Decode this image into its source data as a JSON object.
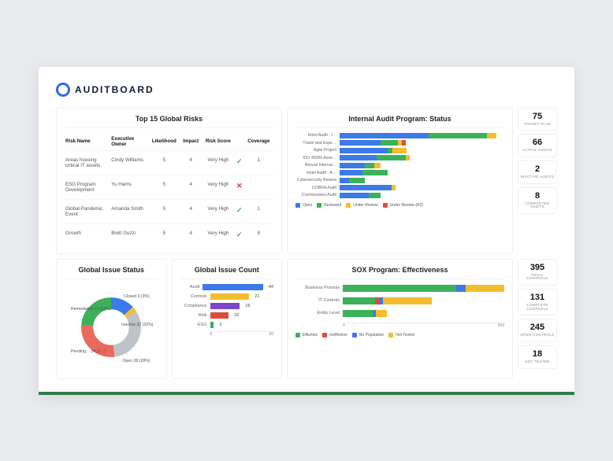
{
  "brand": {
    "name": "AUDITBOARD"
  },
  "risks": {
    "title": "Top 15 Global Risks",
    "columns": [
      "Risk Name",
      "Executive Owner",
      "Likelihood",
      "Impact",
      "Risk Score",
      "",
      "Coverage"
    ],
    "rows": [
      {
        "name": "Areas housing critical IT assets",
        "owner": "Cindy Williams",
        "lik": "5",
        "imp": "4",
        "score": "Very High",
        "covered": true,
        "coverage": "1"
      },
      {
        "name": "ESG Program Development",
        "owner": "Yu Harris",
        "lik": "5",
        "imp": "4",
        "score": "Very High",
        "covered": false,
        "coverage": ""
      },
      {
        "name": "Global Pandemic Event",
        "owner": "Amanda Smith",
        "lik": "5",
        "imp": "4",
        "score": "Very High",
        "covered": true,
        "coverage": "1"
      },
      {
        "name": "Growth",
        "owner": "Brett Guzzi",
        "lik": "5",
        "imp": "4",
        "score": "Very High",
        "covered": true,
        "coverage": "8"
      }
    ]
  },
  "internal_audit": {
    "title": "Internal Audit Program: Status",
    "legend": [
      "Open",
      "Reviewed",
      "Under Review",
      "Under Review (R2)"
    ]
  },
  "chart_data": [
    {
      "name": "internal_audit_status",
      "type": "bar",
      "orientation": "horizontal",
      "stacked": true,
      "categories": [
        "Hotel Audit - I…",
        "Travel and Expe…",
        "Agile Project",
        "ISO 45000 Asse…",
        "Annual Internal…",
        "Hotel Audit - A…",
        "Cybersecurity Review",
        "COBRA Audit",
        "Commissions Audit"
      ],
      "series": [
        {
          "name": "Open",
          "color": "#3b7ae8",
          "values": [
            92,
            42,
            50,
            38,
            26,
            24,
            10,
            54,
            30
          ]
        },
        {
          "name": "Reviewed",
          "color": "#3cb15a",
          "values": [
            60,
            18,
            5,
            30,
            10,
            26,
            16,
            0,
            12
          ]
        },
        {
          "name": "Under Review",
          "color": "#f2bd2e",
          "values": [
            10,
            4,
            14,
            4,
            6,
            0,
            0,
            4,
            0
          ]
        },
        {
          "name": "Under Review (R2)",
          "color": "#de4c3a",
          "values": [
            0,
            4,
            0,
            0,
            0,
            0,
            0,
            0,
            0
          ]
        }
      ],
      "xlim": [
        0,
        170
      ]
    },
    {
      "name": "global_issue_status",
      "type": "pie",
      "donut": true,
      "slices": [
        {
          "label": "Closed",
          "value": 3,
          "pct": 3,
          "color": "#f2bd2e",
          "text": "Closed 3 (3%)"
        },
        {
          "label": "Inactive",
          "value": 32,
          "pct": 32,
          "color": "#bfc3c8",
          "text": "Inactive 32 (32%)"
        },
        {
          "label": "Open",
          "value": 28,
          "pct": 28,
          "color": "#e86a5c",
          "text": "Open 28 (28%)"
        },
        {
          "label": "Pending…",
          "value": 24,
          "pct": 24,
          "color": "#3cb15a",
          "text": "Pending… 24 (2…)"
        },
        {
          "label": "Remediated",
          "value": 13,
          "pct": 13,
          "color": "#3b7ae8",
          "text": "Remediated 13 (13%)"
        }
      ]
    },
    {
      "name": "global_issue_count",
      "type": "bar",
      "orientation": "horizontal",
      "categories": [
        "Audit",
        "Controls",
        "Compliance",
        "Risk",
        "ESG"
      ],
      "values": [
        44,
        21,
        16,
        10,
        2
      ],
      "colors": [
        "#3b7ae8",
        "#f2bd2e",
        "#7b46c7",
        "#de4c3a",
        "#3cb15a"
      ],
      "xlim": [
        0,
        50
      ]
    },
    {
      "name": "sox_effectiveness",
      "type": "bar",
      "orientation": "horizontal",
      "stacked": true,
      "categories": [
        "Business Process",
        "IT Controls",
        "Entity Level"
      ],
      "series": [
        {
          "name": "Effective",
          "color": "#3cb15a",
          "values": [
            140,
            40,
            38
          ]
        },
        {
          "name": "Ineffective",
          "color": "#de4c3a",
          "values": [
            0,
            5,
            0
          ]
        },
        {
          "name": "No Population",
          "color": "#3b7ae8",
          "values": [
            12,
            5,
            3
          ]
        },
        {
          "name": "Not Tested",
          "color": "#f2bd2e",
          "values": [
            48,
            60,
            14
          ]
        }
      ],
      "xlim": [
        0,
        200
      ],
      "xticks": [
        0,
        200
      ]
    }
  ],
  "issue_status": {
    "title": "Global Issue Status"
  },
  "issue_count": {
    "title": "Global Issue Count",
    "axis": [
      "0",
      "50"
    ]
  },
  "sox": {
    "title": "SOX Program: Effectiveness",
    "legend": [
      "Effective",
      "Ineffective",
      "No Population",
      "Not Tested"
    ],
    "axis": [
      "0",
      "200"
    ]
  },
  "stats": [
    {
      "num": "75",
      "lbl": "TARGET PLAN"
    },
    {
      "num": "66",
      "lbl": "ACTIVE AUDITS"
    },
    {
      "num": "2",
      "lbl": "INACTIVE AUDITS"
    },
    {
      "num": "8",
      "lbl": "COMPLETED AUDITS"
    },
    {
      "num": "395",
      "lbl": "TOTAL CONTROLS"
    },
    {
      "num": "131",
      "lbl": "COMPLETE CONTROLS"
    },
    {
      "num": "245",
      "lbl": "OPEN CONTROLS"
    },
    {
      "num": "18",
      "lbl": "NOT TESTED"
    }
  ]
}
